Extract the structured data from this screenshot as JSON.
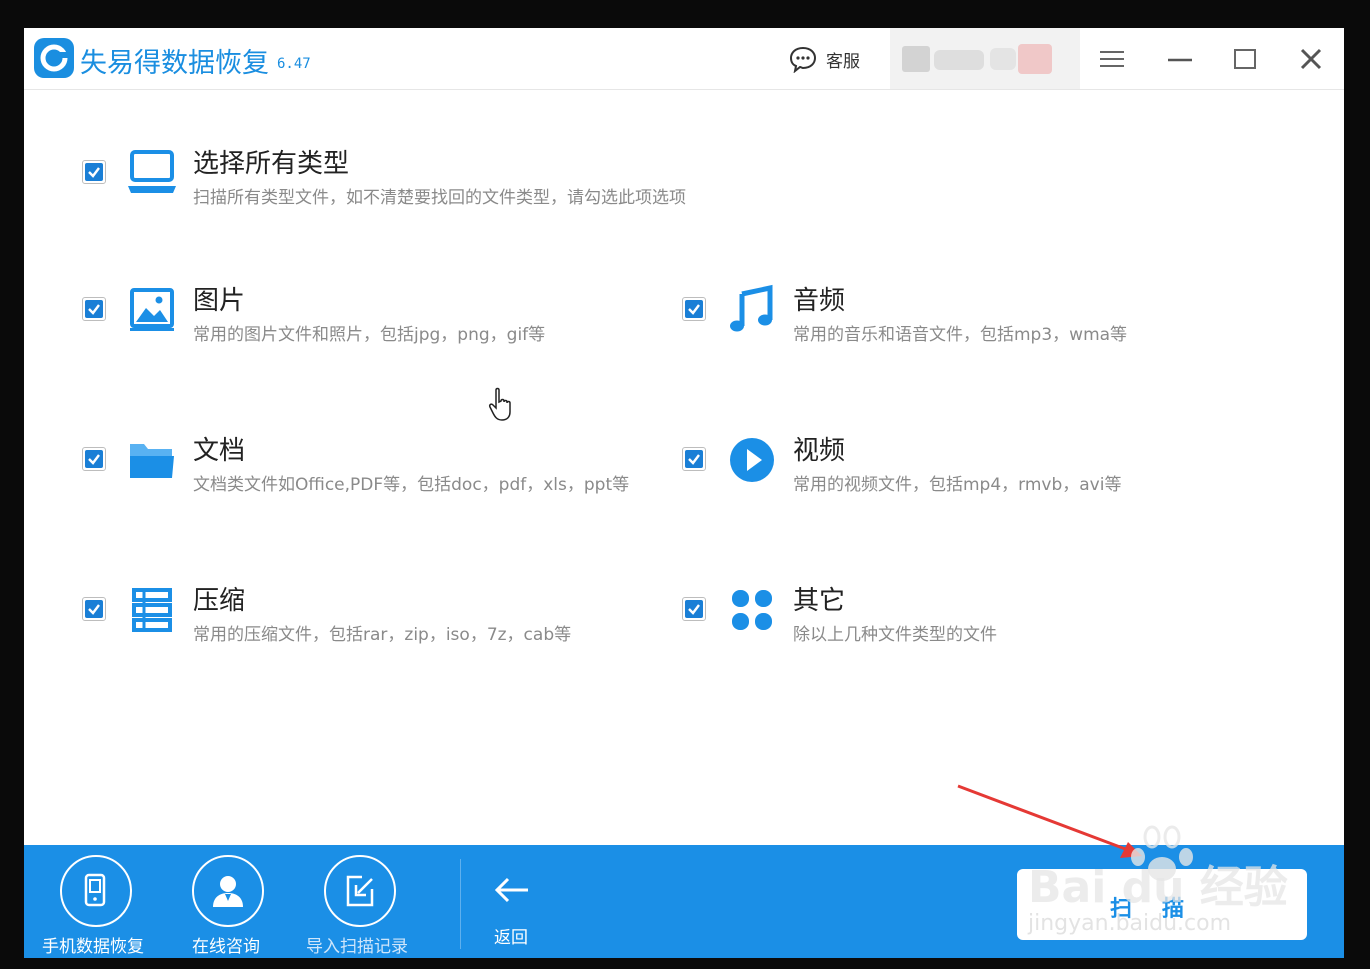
{
  "app": {
    "title": "失易得数据恢复",
    "version": "6.47",
    "service_label": "客服"
  },
  "options": [
    {
      "title": "选择所有类型",
      "desc": "扫描所有类型文件，如不清楚要找回的文件类型，请勾选此项选项",
      "checked": true,
      "icon": "laptop-icon"
    },
    {
      "title": "图片",
      "desc": "常用的图片文件和照片，包括jpg，png，gif等",
      "checked": true,
      "icon": "image-icon"
    },
    {
      "title": "音频",
      "desc": "常用的音乐和语音文件，包括mp3，wma等",
      "checked": true,
      "icon": "music-note-icon"
    },
    {
      "title": "文档",
      "desc": "文档类文件如Office,PDF等，包括doc，pdf，xls，ppt等",
      "checked": true,
      "icon": "folder-icon"
    },
    {
      "title": "视频",
      "desc": "常用的视频文件，包括mp4，rmvb，avi等",
      "checked": true,
      "icon": "play-circle-icon"
    },
    {
      "title": "压缩",
      "desc": "常用的压缩文件，包括rar，zip，iso，7z，cab等",
      "checked": true,
      "icon": "archive-stack-icon"
    },
    {
      "title": "其它",
      "desc": "除以上几种文件类型的文件",
      "checked": true,
      "icon": "grid-dots-icon"
    }
  ],
  "footer": {
    "phone_recovery": "手机数据恢复",
    "online_consult": "在线咨询",
    "import_scan": "导入扫描记录",
    "back": "返回",
    "scan": "扫描"
  },
  "watermark": {
    "brand": "Bai du 经验",
    "url": "jingyan.baidu.com"
  },
  "colors": {
    "accent": "#1b8fe6",
    "title_blue": "#1a8ee0",
    "check_blue": "#1a7fd6"
  }
}
